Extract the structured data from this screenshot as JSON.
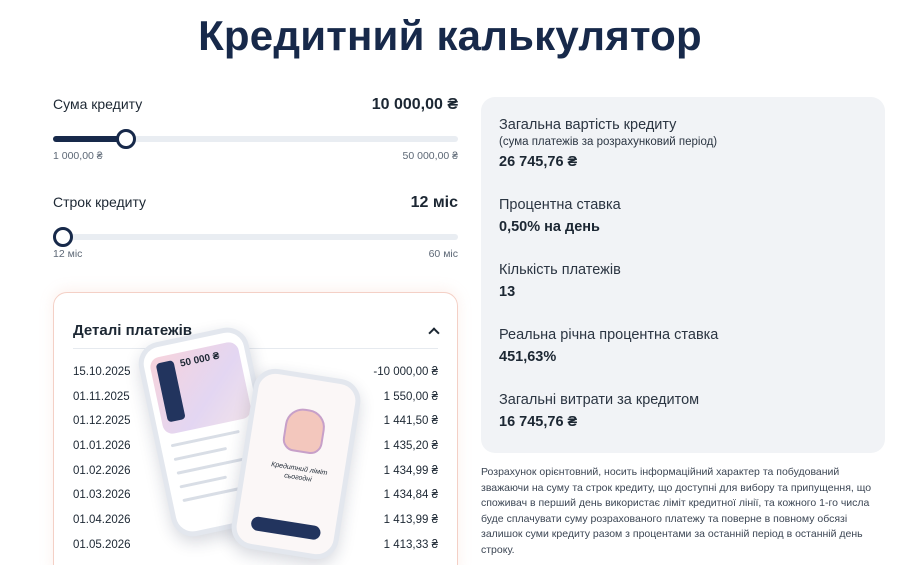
{
  "title": "Кредитний калькулятор",
  "amount_slider": {
    "label": "Сума кредиту",
    "value": "10 000,00 ₴",
    "min_label": "1 000,00 ₴",
    "max_label": "50 000,00 ₴",
    "level": 0.18
  },
  "term_slider": {
    "label": "Строк кредиту",
    "value": "12 міс",
    "min_label": "12 міс",
    "max_label": "60 міс",
    "level": 0.0
  },
  "details": {
    "title": "Деталі платежів",
    "rows": [
      {
        "date": "15.10.2025",
        "amount": "-10 000,00 ₴"
      },
      {
        "date": "01.11.2025",
        "amount": "1 550,00 ₴"
      },
      {
        "date": "01.12.2025",
        "amount": "1 441,50 ₴"
      },
      {
        "date": "01.01.2026",
        "amount": "1 435,20 ₴"
      },
      {
        "date": "01.02.2026",
        "amount": "1 434,99 ₴"
      },
      {
        "date": "01.03.2026",
        "amount": "1 434,84 ₴"
      },
      {
        "date": "01.04.2026",
        "amount": "1 413,99 ₴"
      },
      {
        "date": "01.05.2026",
        "amount": "1 413,33 ₴"
      }
    ]
  },
  "phone_illustration": {
    "card_amount": "50 000 ₴",
    "slogan": "Кредитний ліміт сьогодні"
  },
  "summary": {
    "total_cost_label": "Загальна вартість кредиту",
    "total_cost_sub": "(сума платежів за розрахунковий період)",
    "total_cost_value": "26 745,76 ₴",
    "rate_label": "Процентна ставка",
    "rate_value": "0,50% на день",
    "payments_count_label": "Кількість платежів",
    "payments_count_value": "13",
    "real_rate_label": "Реальна річна процентна ставка",
    "real_rate_value": "451,63%",
    "total_expenses_label": "Загальні витрати за кредитом",
    "total_expenses_value": "16 745,76 ₴"
  },
  "disclaimer": "Розрахунок орієнтовний, носить інформаційний характер та побудований зважаючи на суму та строк кредиту, що доступні для вибору та припущення, що споживач в перший день використає ліміт кредитної лінії, та кожного 1-го числа буде сплачувати суму розрахованого платежу та поверне в повному обсязі залишок суми кредиту разом з процентами за останній період в останній день строку.",
  "colors": {
    "brand_navy": "#17294a",
    "panel_bg": "#f1f3f6",
    "card_border": "#f4d0c6"
  }
}
